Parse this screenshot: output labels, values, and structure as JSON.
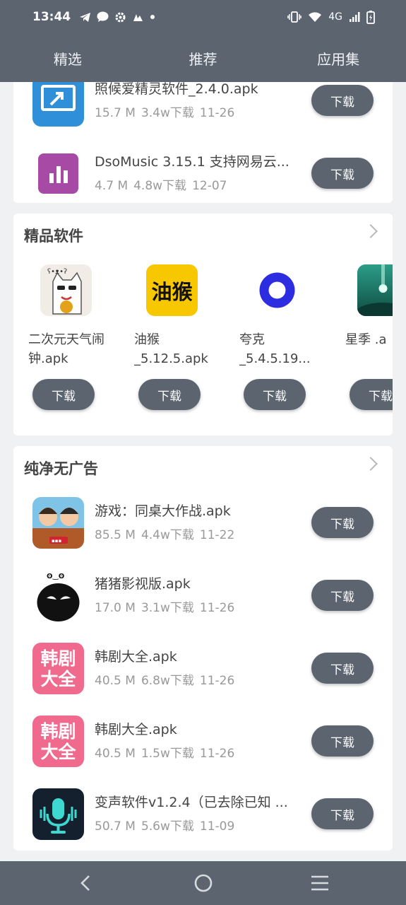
{
  "status_bar": {
    "time": "13:44",
    "network": "4G",
    "left_icons": [
      "telegram-icon",
      "chat-icon",
      "settings-icon",
      "notification-icon",
      "dot-icon"
    ],
    "right_icons": [
      "vibrate-icon",
      "wifi-icon",
      "signal-icon",
      "battery-icon"
    ]
  },
  "tabs": [
    {
      "label": "精选"
    },
    {
      "label": "推荐"
    },
    {
      "label": "应用集"
    }
  ],
  "download_label": "下载",
  "top_list": {
    "items": [
      {
        "title": "照候爱精灵软件_2.4.0.apk",
        "size": "15.7 M",
        "downloads": "3.4w下载",
        "date": "11-26",
        "icon": "screen-share-icon"
      },
      {
        "title": "DsoMusic 3.15.1 支持网易云...",
        "size": "4.7 M",
        "downloads": "4.8w下载",
        "date": "12-07",
        "icon": "music-bars-icon"
      }
    ]
  },
  "premium": {
    "title": "精品软件",
    "items": [
      {
        "name": "二次元天气闹钟.apk",
        "icon": "cartoon-cat-icon"
      },
      {
        "name": "油猴_5.12.5.apk",
        "icon": "youhou-icon",
        "icon_text": "油猴"
      },
      {
        "name": "夸克_5.4.5.19...",
        "icon": "quark-icon"
      },
      {
        "name": "星季 .a",
        "icon": "star-season-icon"
      }
    ]
  },
  "adfree": {
    "title": "纯净无广告",
    "items": [
      {
        "title": "游戏：同桌大作战.apk",
        "size": "85.5 M",
        "downloads": "4.4w下载",
        "date": "11-22",
        "icon": "desk-game-icon"
      },
      {
        "title": "猪猪影视版.apk",
        "size": "17.0 M",
        "downloads": "3.1w下载",
        "date": "11-26",
        "icon": "black-mask-icon"
      },
      {
        "title": "韩剧大全.apk",
        "size": "40.5 M",
        "downloads": "6.8w下载",
        "date": "11-26",
        "icon": "korean-drama-icon",
        "icon_text": "韩剧大全"
      },
      {
        "title": "韩剧大全.apk",
        "size": "40.5 M",
        "downloads": "1.5w下载",
        "date": "11-26",
        "icon": "korean-drama-icon",
        "icon_text": "韩剧大全"
      },
      {
        "title": "变声软件v1.2.4（已去除已知 ...",
        "size": "50.7 M",
        "downloads": "5.6w下载",
        "date": "11-09",
        "icon": "microphone-icon"
      }
    ]
  },
  "colors": {
    "primary": "#5c6470",
    "background": "#eff1f3",
    "card": "#ffffff",
    "meta_text": "#999999"
  },
  "nav_bar": {
    "icons": [
      "back-icon",
      "home-icon",
      "menu-icon"
    ]
  }
}
